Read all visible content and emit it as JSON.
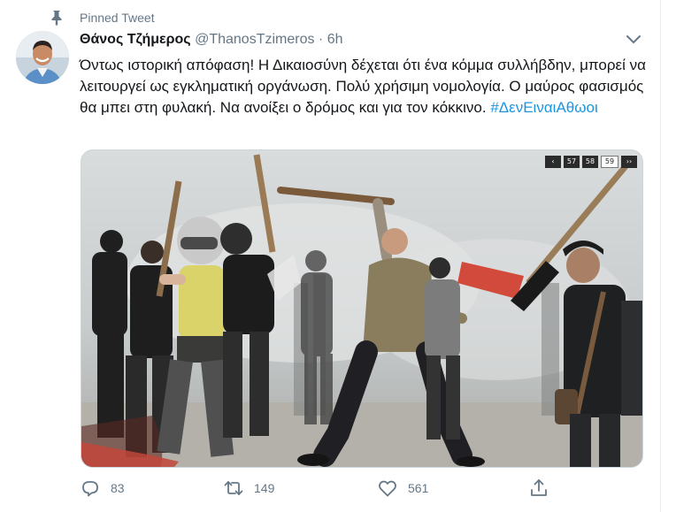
{
  "pinned": {
    "label": "Pinned Tweet"
  },
  "author": {
    "name": "Θάνος Τζήμερος",
    "handle": "@ThanosTzimeros",
    "separator": "·",
    "time": "6h"
  },
  "tweet": {
    "text": "Όντως ιστορική απόφαση! Η Δικαιοσύνη δέχεται ότι ένα κόμμα συλλήβδην, μπορεί να λειτουργεί ως εγκληματική οργάνωση. Πολύ χρήσιμη νομολογία. Ο μαύρος φασισμός θα μπει στη φυλακή. Να ανοίξει ο δρόμος και για τον κόκκινο. ",
    "hashtag": "#ΔενΕιναιΑθωοι"
  },
  "media": {
    "pager": {
      "prev": "‹",
      "pages": [
        "57",
        "58",
        "59"
      ],
      "active_page": "59",
      "next": "››"
    }
  },
  "actions": {
    "replies": "83",
    "retweets": "149",
    "likes": "561"
  },
  "colors": {
    "accent": "#1b95e0",
    "muted": "#657786",
    "text": "#14171a",
    "border": "#e6ecf0"
  },
  "icons": [
    "pin-icon",
    "chevron-down-icon",
    "reply-icon",
    "retweet-icon",
    "like-icon",
    "share-icon"
  ]
}
